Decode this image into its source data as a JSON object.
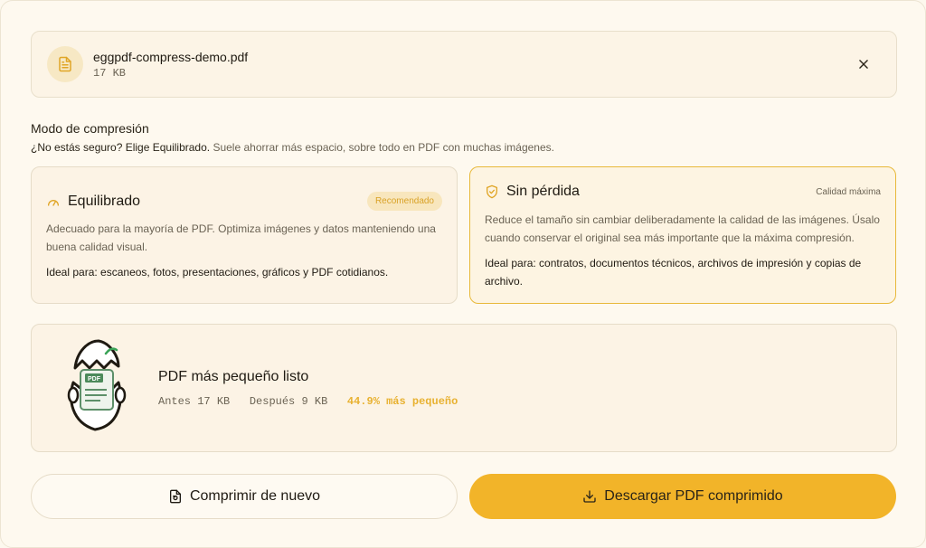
{
  "file": {
    "name": "eggpdf-compress-demo.pdf",
    "size": "17 KB"
  },
  "mode": {
    "title": "Modo de compresión",
    "hint_strong": "¿No estás seguro? Elige Equilibrado.",
    "hint_rest": " Suele ahorrar más espacio, sobre todo en PDF con muchas imágenes."
  },
  "options": [
    {
      "name": "Equilibrado",
      "badge": "Recomendado",
      "description": "Adecuado para la mayoría de PDF. Optimiza imágenes y datos manteniendo una buena calidad visual.",
      "ideal": "Ideal para: escaneos, fotos, presentaciones, gráficos y PDF cotidianos.",
      "selected": false
    },
    {
      "name": "Sin pérdida",
      "badge": "Calidad máxima",
      "description": "Reduce el tamaño sin cambiar deliberadamente la calidad de las imágenes. Úsalo cuando conservar el original sea más importante que la máxima compresión.",
      "ideal": "Ideal para: contratos, documentos técnicos, archivos de impresión y copias de archivo.",
      "selected": true
    }
  ],
  "result": {
    "title": "PDF más pequeño listo",
    "before_label": "Antes",
    "before_value": "17 KB",
    "after_label": "Después",
    "after_value": "9 KB",
    "saving": "44.9% más pequeño",
    "illustration_label": "PDF"
  },
  "actions": {
    "recompress": "Comprimir de nuevo",
    "download": "Descargar PDF comprimido"
  },
  "colors": {
    "accent": "#f2b429",
    "accent_text": "#e8b130",
    "selected_border": "#e8b93a"
  },
  "icons": {
    "file": "file-text-icon",
    "close": "close-icon",
    "balanced": "gauge-icon",
    "lossless": "shield-check-icon",
    "recompress": "file-refresh-icon",
    "download": "download-icon"
  }
}
